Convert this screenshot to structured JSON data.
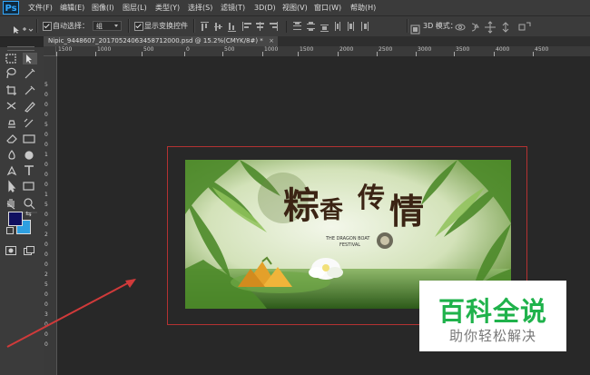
{
  "app": {
    "logo": "Ps"
  },
  "menu": [
    "文件(F)",
    "编辑(E)",
    "图像(I)",
    "图层(L)",
    "类型(Y)",
    "选择(S)",
    "滤镜(T)",
    "3D(D)",
    "视图(V)",
    "窗口(W)",
    "帮助(H)"
  ],
  "options": {
    "auto_select_label": "自动选择：",
    "auto_select_value": "组",
    "show_transform_label": "显示变换控件",
    "mode_3d_label": "3D 模式："
  },
  "document": {
    "tab_title": "Nipic_9448607_20170524063458712000.psd @ 15.2%(CMYK/8#) *",
    "close_glyph": "×"
  },
  "ruler": {
    "h_labels": [
      "1500",
      "1000",
      "500",
      "0",
      "500",
      "1000",
      "1500",
      "2000",
      "2500",
      "3000",
      "3500",
      "4000",
      "4500"
    ],
    "v_labels": [
      "5",
      "0",
      "0",
      "0",
      "5",
      "0",
      "0",
      "1",
      "0",
      "0",
      "0",
      "1",
      "5",
      "0",
      "0",
      "2",
      "0",
      "0",
      "0",
      "2",
      "5",
      "0",
      "0",
      "3",
      "0",
      "0",
      "0"
    ]
  },
  "artwork": {
    "title_chars": [
      "粽",
      "香",
      "传",
      "情"
    ],
    "english_line1": "THE DRAGON BOAT",
    "english_line2": "FESTIVAL"
  },
  "watermark": {
    "title": "百科全说",
    "subtitle": "助你轻松解决"
  },
  "colors": {
    "foreground": "#101060",
    "background": "#2e9fe0",
    "accent_border": "#b43232",
    "watermark_green": "#1fb24b"
  }
}
